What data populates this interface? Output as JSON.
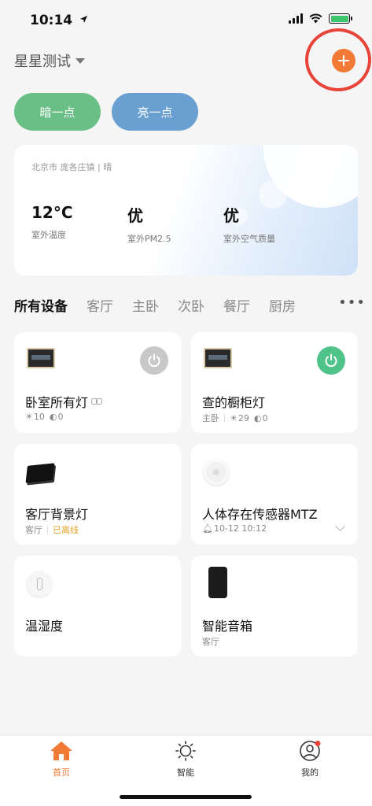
{
  "status_bar": {
    "time": "10:14"
  },
  "header": {
    "home_name": "星星测试"
  },
  "scenes": [
    {
      "label": "暗一点",
      "color": "#6abf86"
    },
    {
      "label": "亮一点",
      "color": "#6a9fd1"
    }
  ],
  "weather": {
    "location": "北京市 庞各庄镇 | 晴",
    "items": [
      {
        "value": "12°C",
        "label": "室外温度"
      },
      {
        "value": "优",
        "label": "室外PM2.5"
      },
      {
        "value": "优",
        "label": "室外空气质量"
      }
    ]
  },
  "room_tabs": [
    "所有设备",
    "客厅",
    "主卧",
    "次卧",
    "餐厅",
    "厨房"
  ],
  "room_tabs_more": "•••",
  "devices": [
    {
      "name": "卧室所有灯",
      "brightness": "10",
      "color_temp": "0",
      "power": "off"
    },
    {
      "name": "查的橱柜灯",
      "room": "主卧",
      "brightness": "29",
      "color_temp": "0",
      "power": "on"
    },
    {
      "name": "客厅背景灯",
      "room": "客厅",
      "status": "已离线"
    },
    {
      "name": "人体存在传感器MTZ",
      "last_event": "10-12 10:12"
    },
    {
      "name": "温湿度"
    },
    {
      "name": "智能音箱",
      "room": "客厅"
    }
  ],
  "tabbar": {
    "items": [
      {
        "label": "首页",
        "icon": "home-icon"
      },
      {
        "label": "智能",
        "icon": "sun-icon"
      },
      {
        "label": "我的",
        "icon": "profile-icon"
      }
    ],
    "active_color": "#f07a36"
  }
}
